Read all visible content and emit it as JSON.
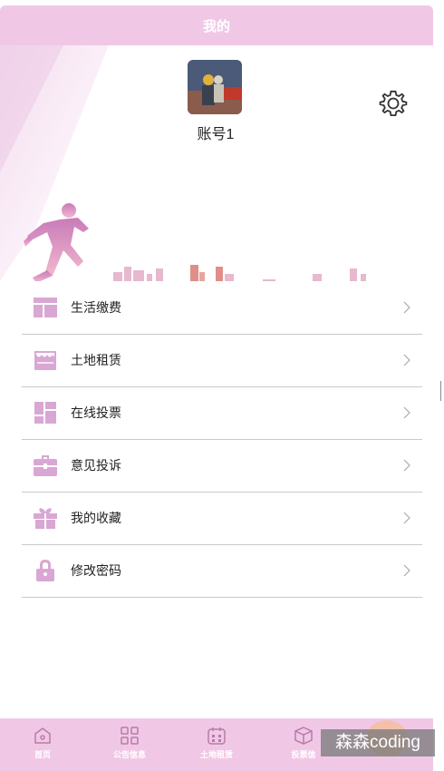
{
  "header": {
    "title": "我的"
  },
  "profile": {
    "username": "账号1"
  },
  "menu": {
    "items": [
      {
        "label": "生活缴费",
        "icon": "table-icon"
      },
      {
        "label": "土地租赁",
        "icon": "storefront-icon"
      },
      {
        "label": "在线投票",
        "icon": "dashboard-icon"
      },
      {
        "label": "意见投诉",
        "icon": "briefcase-icon"
      },
      {
        "label": "我的收藏",
        "icon": "gift-icon"
      },
      {
        "label": "修改密码",
        "icon": "lock-icon"
      }
    ]
  },
  "bottom_nav": {
    "items": [
      {
        "label": "首页",
        "icon": "home-icon"
      },
      {
        "label": "公告信息",
        "icon": "grid-icon"
      },
      {
        "label": "土地租赁",
        "icon": "calendar-icon"
      },
      {
        "label": "投票信",
        "icon": "cube-icon"
      }
    ]
  },
  "watermark": {
    "text": "森森coding"
  },
  "colors": {
    "accent": "#f0c8e6",
    "icon": "#d9a7d3"
  }
}
